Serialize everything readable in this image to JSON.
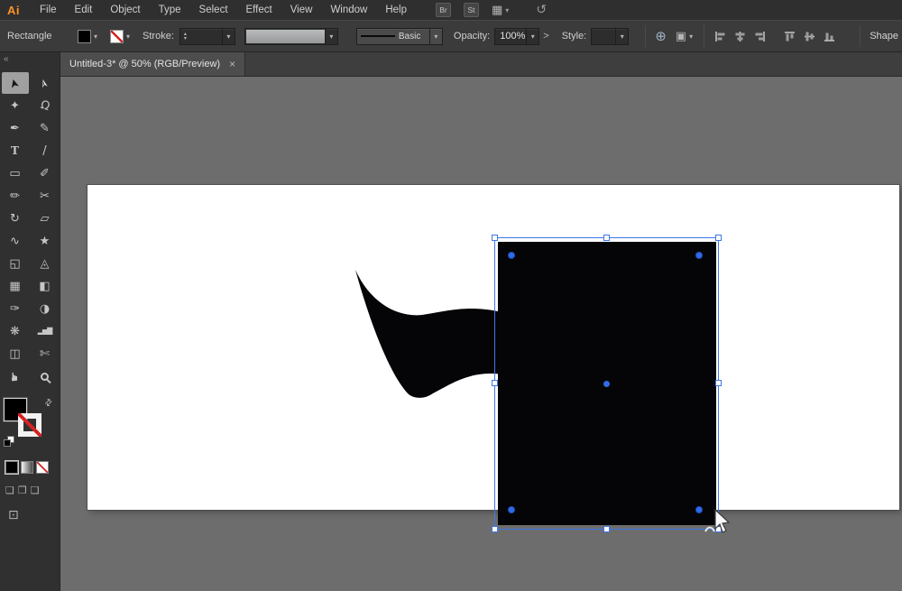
{
  "colors": {
    "selection_blue": "#3d77e8",
    "artboard_white": "#ffffff",
    "object_black": "#050508",
    "logo_orange": "#ff9428",
    "panel_gray": "#303030",
    "canvas_gray": "#6d6d6d"
  },
  "menubar": {
    "logo": "Ai",
    "items": [
      "File",
      "Edit",
      "Object",
      "Type",
      "Select",
      "Effect",
      "View",
      "Window",
      "Help"
    ],
    "badges": [
      "Br",
      "St"
    ]
  },
  "controlbar": {
    "context_label": "Rectangle",
    "stroke_label": "Stroke:",
    "brush_value": "Basic",
    "opacity_label": "Opacity:",
    "opacity_value": "100%",
    "style_label": "Style:",
    "shape_panel_label": "Shape"
  },
  "tabbar": {
    "title": "Untitled-3* @ 50% (RGB/Preview)"
  },
  "icons": {
    "caret": "▾",
    "close": "×",
    "collapse": "«",
    "swap": "⇄",
    "stepper_up": "▴",
    "stepper_down": "▾",
    "flyout": ">",
    "workspace_grid": "▦",
    "sync": "↺",
    "recolor_globe": "⊕",
    "options": "▣",
    "screen_mode": "⊡"
  },
  "toolpanel": {
    "tools": [
      {
        "name": "selection",
        "glyph": "➤"
      },
      {
        "name": "direct-selection",
        "glyph": "➢"
      },
      {
        "name": "magic-wand",
        "glyph": "✦"
      },
      {
        "name": "lasso",
        "glyph": "Ω"
      },
      {
        "name": "pen",
        "glyph": "✒"
      },
      {
        "name": "curvature",
        "glyph": "✎"
      },
      {
        "name": "type",
        "glyph": "T"
      },
      {
        "name": "line-segment",
        "glyph": "/"
      },
      {
        "name": "rectangle",
        "glyph": "▭"
      },
      {
        "name": "paintbrush",
        "glyph": "✐"
      },
      {
        "name": "pencil",
        "glyph": "✏"
      },
      {
        "name": "scissors",
        "glyph": "✂"
      },
      {
        "name": "rotate",
        "glyph": "↻"
      },
      {
        "name": "free-transform",
        "glyph": "▱"
      },
      {
        "name": "width",
        "glyph": "∿"
      },
      {
        "name": "shaper",
        "glyph": "★"
      },
      {
        "name": "shape-builder",
        "glyph": "◱"
      },
      {
        "name": "perspective-grid",
        "glyph": "◬"
      },
      {
        "name": "mesh",
        "glyph": "▦"
      },
      {
        "name": "gradient",
        "glyph": "◧"
      },
      {
        "name": "eyedropper",
        "glyph": "✑"
      },
      {
        "name": "blend",
        "glyph": "◑"
      },
      {
        "name": "symbol-sprayer",
        "glyph": "❋"
      },
      {
        "name": "column-graph",
        "glyph": "▂▅▇"
      },
      {
        "name": "artboard",
        "glyph": "◫"
      },
      {
        "name": "slice",
        "glyph": "✄"
      },
      {
        "name": "hand",
        "glyph": "☛"
      },
      {
        "name": "zoom",
        "glyph": ""
      }
    ],
    "draw_modes": [
      {
        "name": "draw-normal",
        "glyph": "❏"
      },
      {
        "name": "draw-behind",
        "glyph": "❐"
      },
      {
        "name": "draw-inside",
        "glyph": "❑"
      }
    ]
  }
}
